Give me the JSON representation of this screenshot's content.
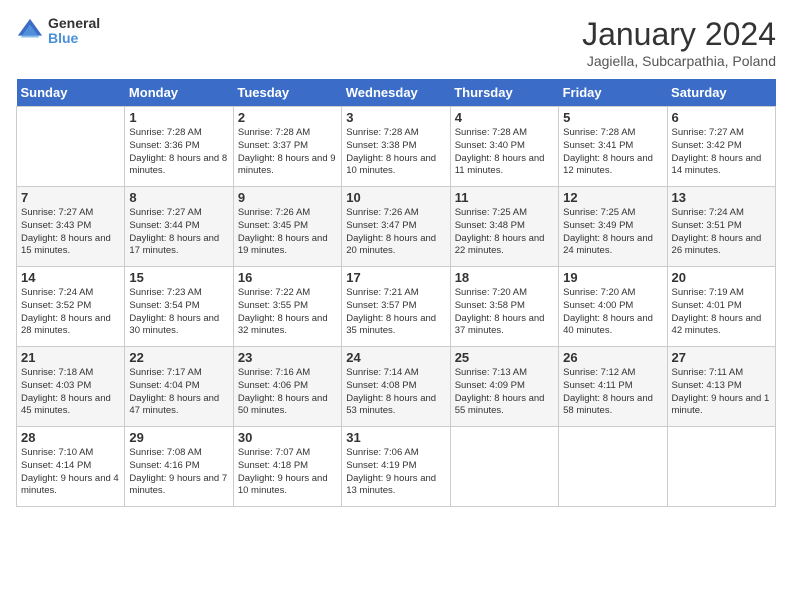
{
  "header": {
    "logo": {
      "line1": "General",
      "line2": "Blue"
    },
    "title": "January 2024",
    "subtitle": "Jagiella, Subcarpathia, Poland"
  },
  "calendar": {
    "days_of_week": [
      "Sunday",
      "Monday",
      "Tuesday",
      "Wednesday",
      "Thursday",
      "Friday",
      "Saturday"
    ],
    "weeks": [
      [
        {
          "day": "",
          "info": ""
        },
        {
          "day": "1",
          "info": "Sunrise: 7:28 AM\nSunset: 3:36 PM\nDaylight: 8 hours\nand 8 minutes."
        },
        {
          "day": "2",
          "info": "Sunrise: 7:28 AM\nSunset: 3:37 PM\nDaylight: 8 hours\nand 9 minutes."
        },
        {
          "day": "3",
          "info": "Sunrise: 7:28 AM\nSunset: 3:38 PM\nDaylight: 8 hours\nand 10 minutes."
        },
        {
          "day": "4",
          "info": "Sunrise: 7:28 AM\nSunset: 3:40 PM\nDaylight: 8 hours\nand 11 minutes."
        },
        {
          "day": "5",
          "info": "Sunrise: 7:28 AM\nSunset: 3:41 PM\nDaylight: 8 hours\nand 12 minutes."
        },
        {
          "day": "6",
          "info": "Sunrise: 7:27 AM\nSunset: 3:42 PM\nDaylight: 8 hours\nand 14 minutes."
        }
      ],
      [
        {
          "day": "7",
          "info": "Sunrise: 7:27 AM\nSunset: 3:43 PM\nDaylight: 8 hours\nand 15 minutes."
        },
        {
          "day": "8",
          "info": "Sunrise: 7:27 AM\nSunset: 3:44 PM\nDaylight: 8 hours\nand 17 minutes."
        },
        {
          "day": "9",
          "info": "Sunrise: 7:26 AM\nSunset: 3:45 PM\nDaylight: 8 hours\nand 19 minutes."
        },
        {
          "day": "10",
          "info": "Sunrise: 7:26 AM\nSunset: 3:47 PM\nDaylight: 8 hours\nand 20 minutes."
        },
        {
          "day": "11",
          "info": "Sunrise: 7:25 AM\nSunset: 3:48 PM\nDaylight: 8 hours\nand 22 minutes."
        },
        {
          "day": "12",
          "info": "Sunrise: 7:25 AM\nSunset: 3:49 PM\nDaylight: 8 hours\nand 24 minutes."
        },
        {
          "day": "13",
          "info": "Sunrise: 7:24 AM\nSunset: 3:51 PM\nDaylight: 8 hours\nand 26 minutes."
        }
      ],
      [
        {
          "day": "14",
          "info": "Sunrise: 7:24 AM\nSunset: 3:52 PM\nDaylight: 8 hours\nand 28 minutes."
        },
        {
          "day": "15",
          "info": "Sunrise: 7:23 AM\nSunset: 3:54 PM\nDaylight: 8 hours\nand 30 minutes."
        },
        {
          "day": "16",
          "info": "Sunrise: 7:22 AM\nSunset: 3:55 PM\nDaylight: 8 hours\nand 32 minutes."
        },
        {
          "day": "17",
          "info": "Sunrise: 7:21 AM\nSunset: 3:57 PM\nDaylight: 8 hours\nand 35 minutes."
        },
        {
          "day": "18",
          "info": "Sunrise: 7:20 AM\nSunset: 3:58 PM\nDaylight: 8 hours\nand 37 minutes."
        },
        {
          "day": "19",
          "info": "Sunrise: 7:20 AM\nSunset: 4:00 PM\nDaylight: 8 hours\nand 40 minutes."
        },
        {
          "day": "20",
          "info": "Sunrise: 7:19 AM\nSunset: 4:01 PM\nDaylight: 8 hours\nand 42 minutes."
        }
      ],
      [
        {
          "day": "21",
          "info": "Sunrise: 7:18 AM\nSunset: 4:03 PM\nDaylight: 8 hours\nand 45 minutes."
        },
        {
          "day": "22",
          "info": "Sunrise: 7:17 AM\nSunset: 4:04 PM\nDaylight: 8 hours\nand 47 minutes."
        },
        {
          "day": "23",
          "info": "Sunrise: 7:16 AM\nSunset: 4:06 PM\nDaylight: 8 hours\nand 50 minutes."
        },
        {
          "day": "24",
          "info": "Sunrise: 7:14 AM\nSunset: 4:08 PM\nDaylight: 8 hours\nand 53 minutes."
        },
        {
          "day": "25",
          "info": "Sunrise: 7:13 AM\nSunset: 4:09 PM\nDaylight: 8 hours\nand 55 minutes."
        },
        {
          "day": "26",
          "info": "Sunrise: 7:12 AM\nSunset: 4:11 PM\nDaylight: 8 hours\nand 58 minutes."
        },
        {
          "day": "27",
          "info": "Sunrise: 7:11 AM\nSunset: 4:13 PM\nDaylight: 9 hours\nand 1 minute."
        }
      ],
      [
        {
          "day": "28",
          "info": "Sunrise: 7:10 AM\nSunset: 4:14 PM\nDaylight: 9 hours\nand 4 minutes."
        },
        {
          "day": "29",
          "info": "Sunrise: 7:08 AM\nSunset: 4:16 PM\nDaylight: 9 hours\nand 7 minutes."
        },
        {
          "day": "30",
          "info": "Sunrise: 7:07 AM\nSunset: 4:18 PM\nDaylight: 9 hours\nand 10 minutes."
        },
        {
          "day": "31",
          "info": "Sunrise: 7:06 AM\nSunset: 4:19 PM\nDaylight: 9 hours\nand 13 minutes."
        },
        {
          "day": "",
          "info": ""
        },
        {
          "day": "",
          "info": ""
        },
        {
          "day": "",
          "info": ""
        }
      ]
    ]
  }
}
